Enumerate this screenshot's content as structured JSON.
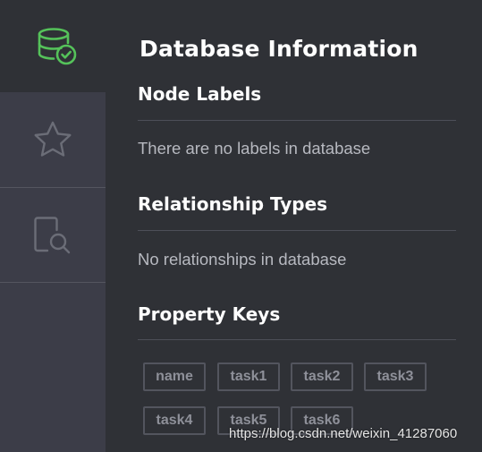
{
  "sidebar": {
    "items": [
      {
        "icon": "database-check-icon",
        "color": "#55c25a"
      },
      {
        "icon": "star-icon",
        "color": "#6b6d77"
      },
      {
        "icon": "document-search-icon",
        "color": "#6b6d77"
      }
    ]
  },
  "panel": {
    "title": "Database Information",
    "node_labels": {
      "heading": "Node Labels",
      "empty": "There are no labels in database"
    },
    "relationship_types": {
      "heading": "Relationship Types",
      "empty": "No relationships in database"
    },
    "property_keys": {
      "heading": "Property Keys",
      "keys": [
        "name",
        "task1",
        "task2",
        "task3",
        "task4",
        "task5",
        "task6"
      ]
    }
  },
  "watermark": "https://blog.csdn.net/weixin_41287060"
}
